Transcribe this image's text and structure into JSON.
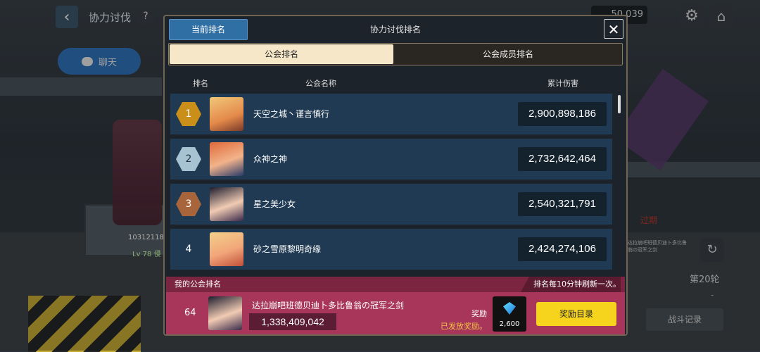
{
  "header": {
    "title": "协力讨伐",
    "help": "?",
    "currency_value": "50,039"
  },
  "chat": {
    "label": "聊天"
  },
  "side": {
    "expired": "过期",
    "small_text": "达拉崩吧班德贝迪卜多比鲁翁の冠军之剑",
    "round": "第20轮",
    "dash": "-",
    "battle_record": "战斗记录",
    "hp": "10312118",
    "level": "Lv 78 侵"
  },
  "modal": {
    "tab_current": "当前排名",
    "title": "协力讨伐排名",
    "close": "✕",
    "segments": {
      "guild": "公会排名",
      "member": "公会成员排名"
    },
    "columns": {
      "rank": "排名",
      "name": "公会名称",
      "damage": "累计伤害"
    },
    "rows": [
      {
        "rank": "1",
        "name": "天空之城丶谨言慎行",
        "damage": "2,900,898,186"
      },
      {
        "rank": "2",
        "name": "众神之神",
        "damage": "2,732,642,464"
      },
      {
        "rank": "3",
        "name": "星之美少女",
        "damage": "2,540,321,791"
      },
      {
        "rank": "4",
        "name": "砂之雪原黎明奇缘",
        "damage": "2,424,274,106"
      }
    ],
    "my_guild": {
      "title": "我的公会排名",
      "note": "排名每10分钟刷新一次。",
      "rank": "64",
      "name": "达拉崩吧班德贝迪卜多比鲁翁の冠军之剑",
      "damage": "1,338,409,042",
      "reward_label": "奖励",
      "reward_sent": "已发放奖励。",
      "gem_count": "2,600",
      "reward_button": "奖励目录"
    }
  },
  "colors": {
    "gold": "#c98f18",
    "silver": "#a7c3d1",
    "bronze": "#a8643a",
    "row_bg": "#1f3a52",
    "my_bg": "#a8365a",
    "reward_btn": "#f6d31c"
  }
}
